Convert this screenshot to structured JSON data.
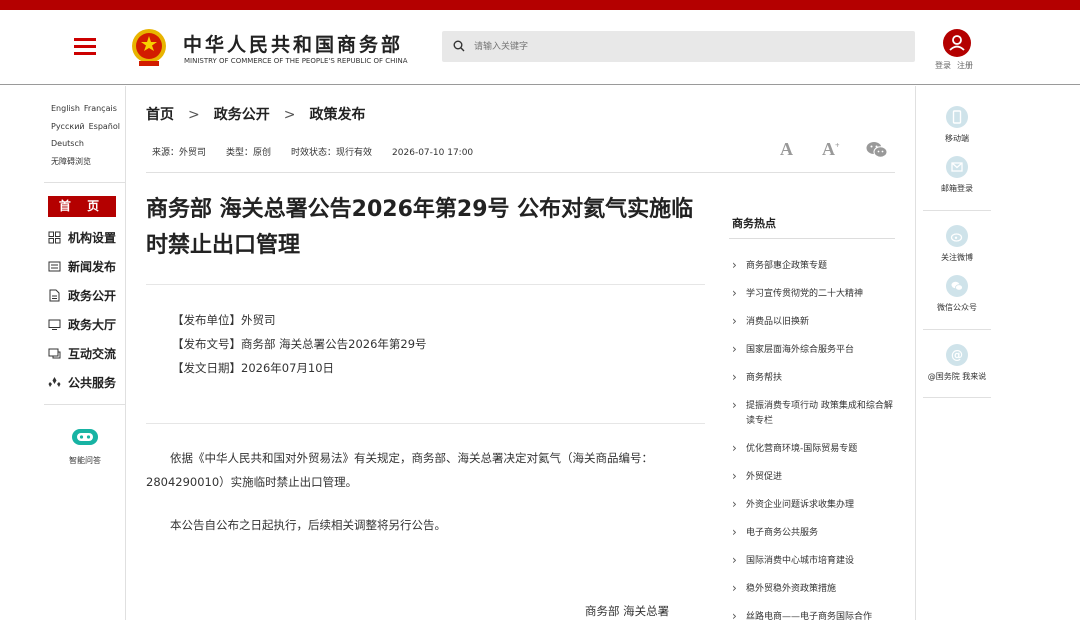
{
  "header": {
    "title_cn": "中华人民共和国商务部",
    "title_en": "MINISTRY OF COMMERCE OF THE PEOPLE'S REPUBLIC OF CHINA",
    "search_placeholder": "请输入关键字",
    "login": "登录",
    "register": "注册",
    "brand_color": "#b40000"
  },
  "leftnav": {
    "languages": [
      "English",
      "Français",
      "Русский",
      "Español",
      "Deutsch",
      "无障碍浏览"
    ],
    "home": "首 页",
    "items": [
      "机构设置",
      "新闻发布",
      "政务公开",
      "政务大厅",
      "互动交流",
      "公共服务"
    ],
    "assistant": "智能问答"
  },
  "breadcrumb": [
    "首页",
    "政务公开",
    "政策发布"
  ],
  "meta": {
    "source": "来源：外贸司",
    "type": "类型：原创",
    "status": "时效状态：现行有效",
    "date": "2026-07-10 17:00"
  },
  "article": {
    "title": "商务部 海关总署公告2026年第29号 公布对氦气实施临时禁止出口管理",
    "unit": "【发布单位】外贸司",
    "doc_no": "【发布文号】商务部 海关总署公告2026年第29号",
    "doc_date": "【发文日期】2026年07月10日",
    "para1": "依据《中华人民共和国对外贸易法》有关规定，商务部、海关总署决定对氦气（海关商品编号：2804290010）实施临时禁止出口管理。",
    "para2": "本公告自公布之日起执行，后续相关调整将另行公告。",
    "signature": "商务部  海关总署"
  },
  "hot": {
    "title": "商务热点",
    "items": [
      "商务部惠企政策专题",
      "学习宣传贯彻党的二十大精神",
      "消费品以旧换新",
      "国家层面海外综合服务平台",
      "商务帮扶",
      "提振消费专项行动 政策集成和综合解读专栏",
      "优化营商环境-国际贸易专题",
      "外贸促进",
      "外资企业问题诉求收集办理",
      "电子商务公共服务",
      "国际消费中心城市培育建设",
      "稳外贸稳外资政策措施",
      "丝路电商——电子商务国际合作"
    ]
  },
  "rightside": {
    "items": [
      "移动端",
      "邮箱登录",
      "关注微博",
      "微信公众号",
      "@国务院 我来说"
    ]
  }
}
